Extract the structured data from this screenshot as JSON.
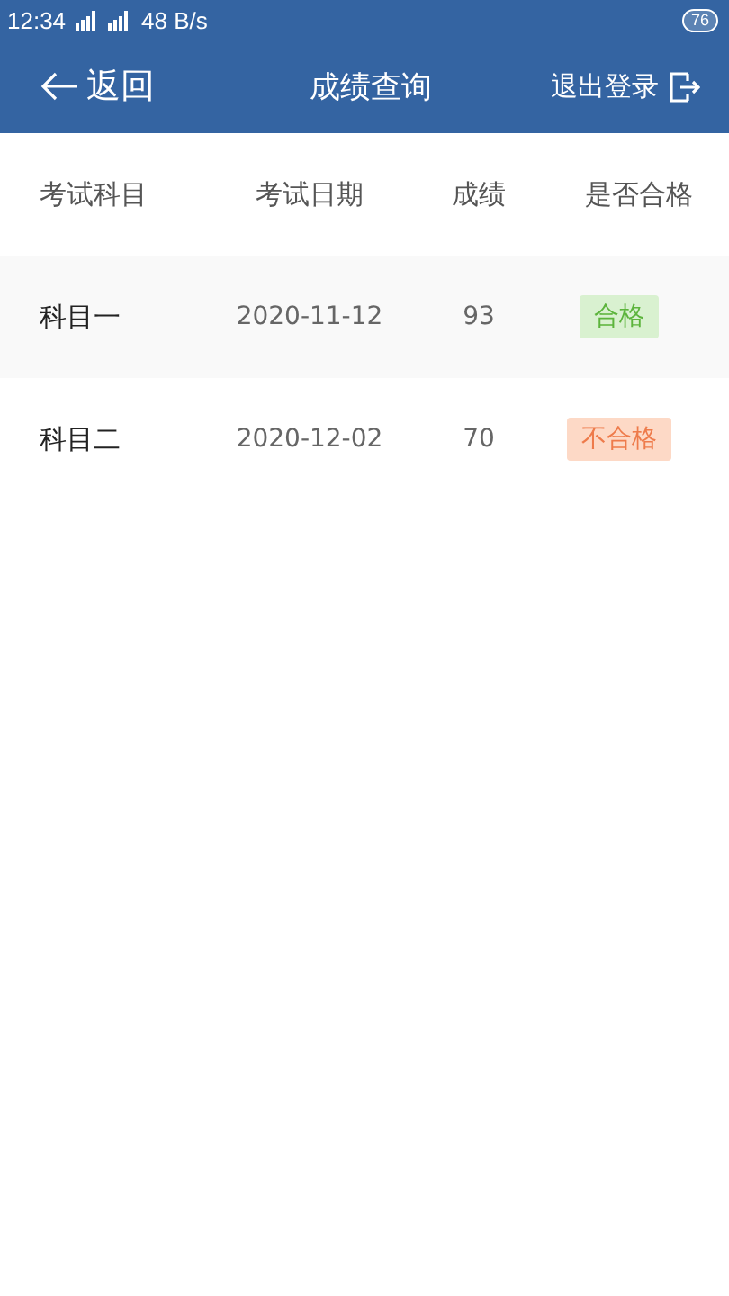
{
  "status_bar": {
    "time": "12:34",
    "speed": "48 B/s",
    "battery": "76"
  },
  "header": {
    "back": "返回",
    "title": "成绩查询",
    "logout": "退出登录"
  },
  "table": {
    "columns": [
      "考试科目",
      "考试日期",
      "成绩",
      "是否合格"
    ],
    "rows": [
      {
        "subject": "科目一",
        "date": "2020-11-12",
        "score": "93",
        "result": "合格",
        "passed": true
      },
      {
        "subject": "科目二",
        "date": "2020-12-02",
        "score": "70",
        "result": "不合格",
        "passed": false
      }
    ]
  }
}
